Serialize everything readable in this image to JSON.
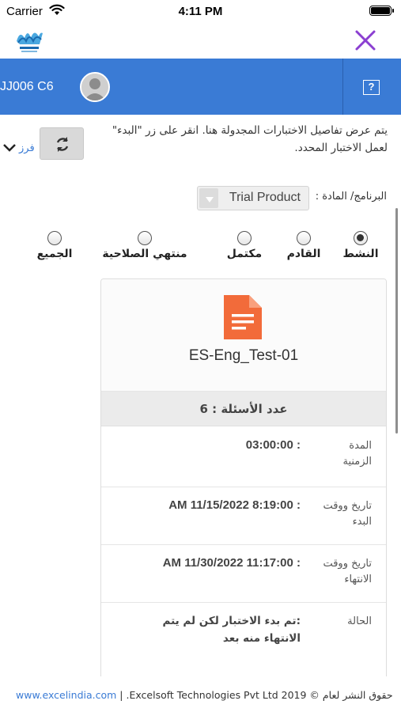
{
  "status_bar": {
    "carrier": "Carrier",
    "time": "4:11 PM"
  },
  "header": {
    "user_code": "JJ006 C6",
    "help_label": "?"
  },
  "filter": {
    "sort_label": "فرز"
  },
  "instructions": "يتم عرض تفاصيل الاختبارات المجدولة هنا. انقر على زر \"البدء\" لعمل الاختبار المحدد.",
  "program": {
    "label": "البرنامج/ المادة :",
    "selected": "Trial Product"
  },
  "status_filters": [
    {
      "label": "النشط",
      "checked": true
    },
    {
      "label": "القادم",
      "checked": false
    },
    {
      "label": "مكتمل",
      "checked": false
    },
    {
      "label": "منتهي الصلاحية",
      "checked": false
    },
    {
      "label": "الجميع",
      "checked": false
    }
  ],
  "test": {
    "name": "ES-Eng_Test-01",
    "question_count": "عدد الأسئلة : 6",
    "duration_label": "المدة الزمنية",
    "duration_value": ": 03:00:00",
    "start_label": "تاريخ ووقت البدء",
    "start_value": ": 8:19:00 11/15/2022 AM",
    "end_label": "تاريخ ووقت الانتهاء",
    "end_value": ": 11:17:00 11/30/2022 AM",
    "status_label": "الحالة",
    "status_value": ":تم بدء الاختبار لكن لم يتم الانتهاء منه بعد"
  },
  "footer": {
    "link": "www.excelindia.com",
    "copyright": " | .Excelsoft Technologies Pvt Ltd 2019 © حقوق النشر لعام"
  },
  "colors": {
    "header_blue": "#3a7bd5",
    "close_purple": "#8b3fd1",
    "doc_orange": "#f26b3a"
  }
}
